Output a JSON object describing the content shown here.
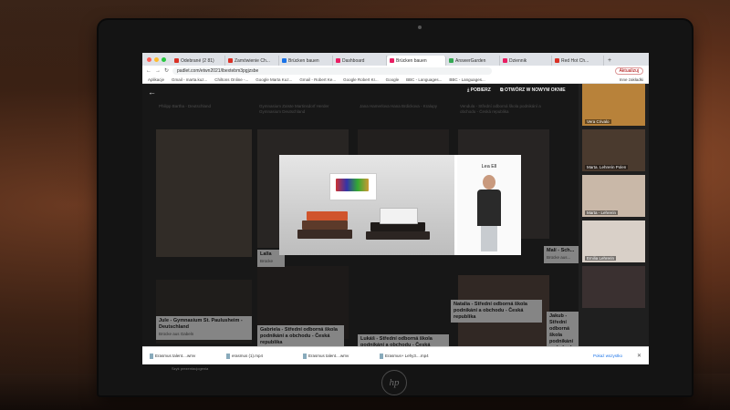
{
  "browser": {
    "tabs": [
      {
        "label": "Odebrané (2 81)",
        "color": "#d93025"
      },
      {
        "label": "Zamówienie Ch...",
        "color": "#d93025"
      },
      {
        "label": "Brücken bauen",
        "color": "#1a73e8"
      },
      {
        "label": "Dashboard",
        "color": "#e91e63"
      },
      {
        "label": "Brücken bauen",
        "color": "#e91e63"
      },
      {
        "label": "AnswerGarden",
        "color": "#34a853"
      },
      {
        "label": "Dziennik",
        "color": "#e91e63"
      },
      {
        "label": "Red Hot Ch...",
        "color": "#d93025"
      }
    ],
    "active_tab": 4,
    "new_tab": "+",
    "url": "padlet.com/etwn2021/lbextebm3pgjzsbe",
    "update_label": "Aktualizuj",
    "bookmarks": [
      "Aplikacje",
      "Gmail - marta.kuz...",
      "Chiltons Online -...",
      "Google Marta Kuz...",
      "Gmail - Robert Ke...",
      "Google Robert Kr...",
      "Google",
      "BBC - Languages...",
      "BBC - Languages...",
      "Inne zakładki"
    ]
  },
  "padlet": {
    "download_label": "POBIERZ",
    "open_label": "OTWÓRZ W NOWYM OKNIE",
    "column_headers": [
      "Philipp Bartha - Deutschland",
      "Gymnasium Zaïste Martinsdorf Herder Gymnasium Deutschland",
      "Jana Hamerlova Hana Brdickova - Kralupy",
      "Vendula - Střední odborná škola podnikání a obchodu - Česká republika"
    ],
    "cards": [
      {
        "title": "Jule - Gymnasium St. Paulusheim - Deutschland",
        "sub": "Brücke aus Gabeln"
      },
      {
        "title": "Gabriela - Střední odborná škola podnikání a obchodu - Česká republika",
        "sub": ""
      },
      {
        "title": "Lukáš - Střední odborná škola podnikání a obchodu - Česká republika",
        "sub": ""
      },
      {
        "title": "Natalia - Střední odborná škola podnikání a obchodu - Česká republika",
        "sub": ""
      },
      {
        "title": "Jakub - Střední odborná škola podnikání a obchodu",
        "sub": ""
      },
      {
        "title": "Lalla",
        "sub": "Brücke"
      },
      {
        "title": "Malí - Sch...",
        "sub": "Brücke aus..."
      }
    ],
    "lightbox": {
      "person_name": "Lea Ell"
    }
  },
  "video_call": {
    "participants": [
      {
        "name": "Vera Crivalo",
        "bg": "#b8823a"
      },
      {
        "name": "Marta. Lehrerin Polen",
        "bg": "#4a3a2e"
      },
      {
        "name": "Marta - Lehrerin",
        "bg": "#c9b8a8"
      },
      {
        "name": "Emilia Lehrerin",
        "bg": "#d9d0c8"
      },
      {
        "name": "",
        "bg": "#3a3030"
      }
    ]
  },
  "downloads": {
    "items": [
      "Erasmus talent....wmv",
      "erasmus (1).mp4",
      "Erasmus talent....wmv",
      "Erasmus+ Lehy3....mp4"
    ],
    "show_all": "Pokaż wszystko",
    "overflow_text": "Szyk prezentacjogenia"
  }
}
